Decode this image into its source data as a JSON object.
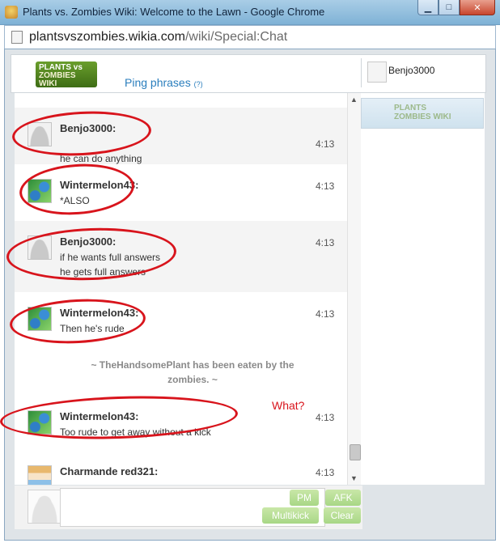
{
  "window": {
    "title": "Plants vs. Zombies Wiki: Welcome to the Lawn - Google Chrome"
  },
  "address": {
    "url_domain": "plantsvszombies.wikia.com",
    "url_path": "/wiki/Special:Chat"
  },
  "header": {
    "logo_line1": "PLANTS vs",
    "logo_line2": "ZOMBIES WIKI",
    "ping_label": "Ping phrases",
    "ping_help": "(?)",
    "current_user": "Benjo3000"
  },
  "room": {
    "logo_line1": "PLANTS",
    "logo_line2": "ZOMBIES WIKI"
  },
  "messages": [
    {
      "user": "Benjo3000:",
      "time": "4:13",
      "lines": [
        "he can do anything"
      ]
    },
    {
      "user": "Wintermelon43:",
      "time": "4:13",
      "lines": [
        "*ALSO"
      ]
    },
    {
      "user": "Benjo3000:",
      "time": "4:13",
      "lines": [
        "if he wants full answers",
        "he gets full answers"
      ]
    },
    {
      "user": "Wintermelon43:",
      "time": "4:13",
      "lines": [
        "Then he's rude"
      ]
    },
    {
      "user": "Wintermelon43:",
      "time": "4:13",
      "lines": [
        "Too rude to get away without a kick"
      ]
    },
    {
      "user": "Charmande red321:",
      "time": "4:13",
      "lines": [
        ""
      ]
    }
  ],
  "inline_alert": "~ TheHandsomePlant has been eaten by the zombies. ~",
  "annotation": "What?",
  "buttons": {
    "pm": "PM",
    "afk": "AFK",
    "multikick": "Multikick",
    "clear": "Clear"
  },
  "colors": {
    "accent_link": "#2a7ebd",
    "annotation_red": "#d8141c",
    "button_green": "#a8d786"
  }
}
